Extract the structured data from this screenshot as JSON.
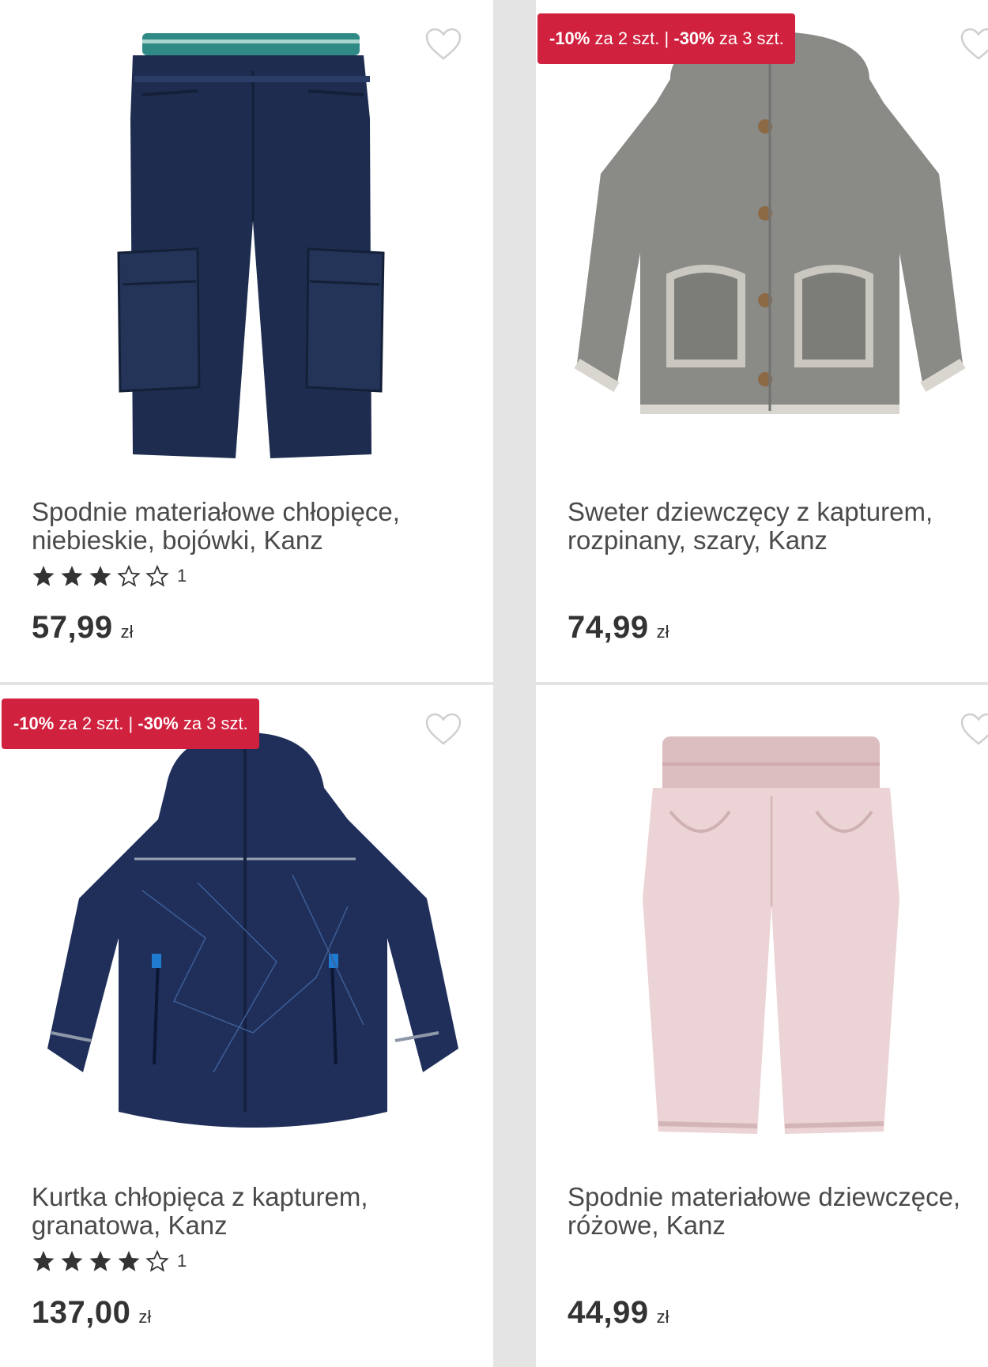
{
  "accent_color": "#d0223f",
  "products": [
    {
      "title_line1": "Spodnie materiałowe chłopięce,",
      "title_line2": "niebieskie, bojówki, Kanz",
      "rating": 3,
      "rating_count": "1",
      "price": "57,99",
      "currency": "zł",
      "image": "navy cargo pants",
      "wishlist_icon": "heart-outline-icon"
    },
    {
      "promo_part1_pct": "-10%",
      "promo_part1_text": "za 2 szt.",
      "promo_sep": "|",
      "promo_part2_pct": "-30%",
      "promo_part2_text": "za 3 szt.",
      "title_line1": "Sweter dziewczęcy z kapturem,",
      "title_line2": "rozpinany, szary, Kanz",
      "price": "74,99",
      "currency": "zł",
      "image": "grey knitted hooded cardigan",
      "wishlist_icon": "heart-outline-icon"
    },
    {
      "promo_part1_pct": "-10%",
      "promo_part1_text": "za 2 szt.",
      "promo_sep": "|",
      "promo_part2_pct": "-30%",
      "promo_part2_text": "za 3 szt.",
      "title_line1": "Kurtka chłopięca z kapturem,",
      "title_line2": "granatowa, Kanz",
      "rating": 4,
      "rating_count": "1",
      "price": "137,00",
      "currency": "zł",
      "image": "navy hooded jacket",
      "wishlist_icon": "heart-outline-icon"
    },
    {
      "title_line1": "Spodnie materiałowe dziewczęce,",
      "title_line2": "różowe, Kanz",
      "price": "44,99",
      "currency": "zł",
      "image": "pink baby trousers",
      "wishlist_icon": "heart-outline-icon"
    }
  ]
}
